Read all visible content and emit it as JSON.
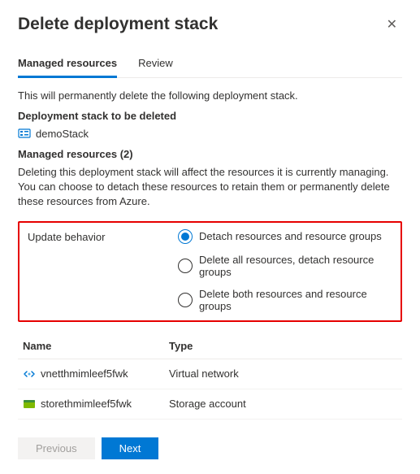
{
  "header": {
    "title": "Delete deployment stack"
  },
  "tabs": [
    {
      "label": "Managed resources",
      "active": true
    },
    {
      "label": "Review",
      "active": false
    }
  ],
  "intro": "This will permanently delete the following deployment stack.",
  "deleteLabel": "Deployment stack to be deleted",
  "stackName": "demoStack",
  "managedLabel": "Managed resources (2)",
  "description": "Deleting this deployment stack will affect the resources it is currently managing. You can choose to detach these resources to retain them or permanently delete these resources from Azure.",
  "behavior": {
    "label": "Update behavior",
    "options": [
      {
        "label": "Detach resources and resource groups",
        "selected": true
      },
      {
        "label": "Delete all resources, detach resource groups",
        "selected": false
      },
      {
        "label": "Delete both resources and resource groups",
        "selected": false
      }
    ]
  },
  "table": {
    "headers": {
      "name": "Name",
      "type": "Type"
    },
    "rows": [
      {
        "name": "vnetthmimleef5fwk",
        "type": "Virtual network",
        "icon": "vnet"
      },
      {
        "name": "storethmimleef5fwk",
        "type": "Storage account",
        "icon": "storage"
      }
    ]
  },
  "buttons": {
    "previous": "Previous",
    "next": "Next"
  }
}
